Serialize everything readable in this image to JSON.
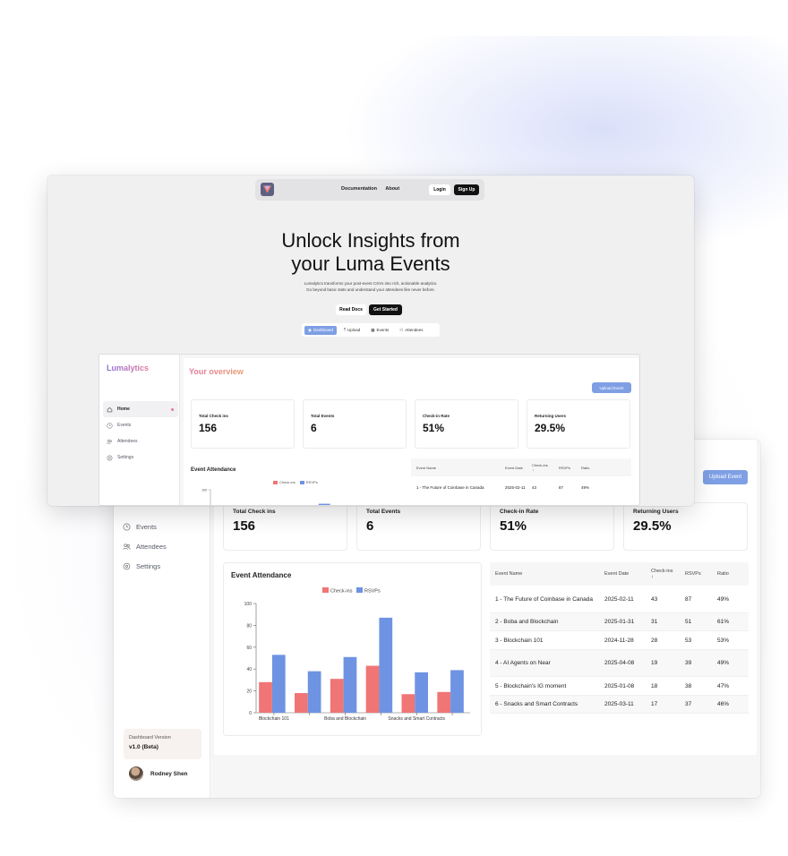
{
  "landing": {
    "nav": {
      "documentation": "Documentation",
      "about": "About",
      "login": "Login",
      "signup": "Sign Up"
    },
    "hero_title_line1": "Unlock Insights from",
    "hero_title_line2": "your Luma Events",
    "hero_sub_line1": "Lumalytics transforms your post-event CSVs into rich, actionable analytics.",
    "hero_sub_line2": "Go beyond basic stats and understand your attendees like never before.",
    "read_docs": "Read Docs",
    "get_started": "Get Started",
    "tabs": [
      {
        "label": "Dashboard",
        "icon": "dashboard-icon"
      },
      {
        "label": "Upload",
        "icon": "upload-icon"
      },
      {
        "label": "Events",
        "icon": "calendar-icon"
      },
      {
        "label": "Attendees",
        "icon": "users-icon"
      }
    ]
  },
  "app": {
    "brand": "Lumalytics",
    "overview_title": "Your overview",
    "upload_event": "Upload Event",
    "nav": [
      {
        "label": "Home",
        "icon": "home-icon"
      },
      {
        "label": "Events",
        "icon": "clock-icon"
      },
      {
        "label": "Attendees",
        "icon": "users-icon"
      },
      {
        "label": "Settings",
        "icon": "gear-icon"
      }
    ],
    "stats": [
      {
        "label": "Total Check ins",
        "value": "156"
      },
      {
        "label": "Total Events",
        "value": "6"
      },
      {
        "label": "Check-in Rate",
        "value": "51%"
      },
      {
        "label": "Returning Users",
        "value": "29.5%"
      }
    ],
    "attendance_title": "Event Attendance",
    "version_label": "Dashboard Version",
    "version_value": "v1.0 (Beta)",
    "user_name": "Rodney Shen",
    "table": {
      "headers": [
        "Event Name",
        "Event Date",
        "Check-ins",
        "RSVPs",
        "Ratio"
      ],
      "sort_arrow": "↓",
      "rows": [
        [
          "1 - The Future of Coinbase in Canada",
          "2025-02-11",
          "43",
          "87",
          "49%"
        ],
        [
          "2 - Boba and Blockchain",
          "2025-01-31",
          "31",
          "51",
          "61%"
        ],
        [
          "3 - Blockchain 101",
          "2024-11-28",
          "28",
          "53",
          "53%"
        ],
        [
          "4 - AI Agents on Near",
          "2025-04-08",
          "19",
          "39",
          "49%"
        ],
        [
          "5 - Blockchain's IG moment",
          "2025-01-08",
          "18",
          "38",
          "47%"
        ],
        [
          "6 - Snacks and Smart Contracts",
          "2025-03-11",
          "17",
          "37",
          "46%"
        ]
      ]
    }
  },
  "chart_data": {
    "type": "bar",
    "x_tick_labels": [
      "Blockchain 101",
      "Boba and Blockchain",
      "Snacks and Smart Contracts"
    ],
    "series": [
      {
        "name": "Check-ins",
        "color": "#f07575",
        "values": [
          28,
          18,
          31,
          43,
          17,
          19
        ]
      },
      {
        "name": "RSVPs",
        "color": "#6f93e3",
        "values": [
          53,
          38,
          51,
          87,
          37,
          39
        ]
      }
    ],
    "yticks": [
      0,
      20,
      40,
      60,
      80,
      100
    ],
    "ylim": [
      0,
      100
    ],
    "legend": "top-center"
  }
}
